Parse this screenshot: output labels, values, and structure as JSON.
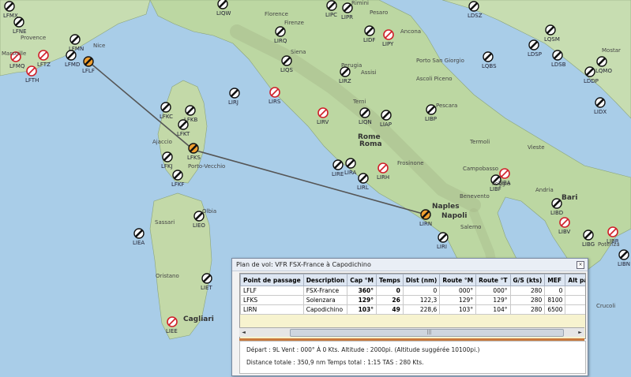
{
  "map": {
    "cities": [
      "Marseille",
      "Provence",
      "Nice",
      "Florence",
      "Firenze",
      "Rimini",
      "Pesaro",
      "Ancona",
      "Siena",
      "Perugia",
      "Assisi",
      "Porto San Giorgio",
      "Ascoli Piceno",
      "Terni",
      "Pescara",
      "Rome",
      "Roma",
      "Frosinone",
      "Termoli",
      "Vieste",
      "Campobasso",
      "Benevento",
      "Foggia",
      "Naples",
      "Napoli",
      "Salerno",
      "Andria",
      "Bari",
      "Mostar",
      "Porto-Vecchio",
      "Olbia",
      "Sassari",
      "Oristano",
      "Cagliari",
      "Potenza",
      "Crucoli",
      "Ajaccio"
    ],
    "airports": [
      "LFMX",
      "LFNE",
      "LFMN",
      "LFMD",
      "LFTZ",
      "LFTH",
      "LFMQ",
      "LFLF",
      "LIQW",
      "LIRQ",
      "LIPC",
      "LIPR",
      "LIDF",
      "LIPY",
      "LDSZ",
      "LDSB",
      "LQMO",
      "LQSM",
      "LQBS",
      "LDDP",
      "LDSP",
      "LIQS",
      "LIRZ",
      "LIRS",
      "LIRJ",
      "LFKC",
      "LFKB",
      "LFKT",
      "LFKS",
      "LFKJ",
      "LFKF",
      "LIRV",
      "LIQN",
      "LIAP",
      "LIBP",
      "LIRA",
      "LIRL",
      "LIRE",
      "LIRH",
      "LIBF",
      "LIBA",
      "LIRN",
      "LIRI",
      "LIBD",
      "LIBV",
      "LIBG",
      "LIBR",
      "LIBN",
      "LIEO",
      "LIEA",
      "LIET",
      "LIEE",
      "LIDX"
    ]
  },
  "panel": {
    "title": "Plan de vol: VFR FSX-France à Capodichino",
    "close": "×",
    "columns": [
      "Point de passage",
      "Description",
      "Cap °M",
      "Temps",
      "Dist (nm)",
      "Route °M",
      "Route °T",
      "G/S (kts)",
      "MEF",
      "Alt par"
    ],
    "rows": [
      {
        "wp": "LFLF",
        "desc": "FSX-France",
        "cap": "360°",
        "temps": "0",
        "dist": "0",
        "rm": "000°",
        "rt": "000°",
        "gs": "280",
        "mef": "0"
      },
      {
        "wp": "LFKS",
        "desc": "Solenzara",
        "cap": "129°",
        "temps": "26",
        "dist": "122,3",
        "rm": "129°",
        "rt": "129°",
        "gs": "280",
        "mef": "8100"
      },
      {
        "wp": "LIRN",
        "desc": "Capodichino",
        "cap": "103°",
        "temps": "49",
        "dist": "228,6",
        "rm": "103°",
        "rt": "104°",
        "gs": "280",
        "mef": "6500"
      }
    ],
    "scroll_left": "◄",
    "scroll_right": "►",
    "scroll_grip": "|||",
    "summary": {
      "line1": "Départ :  9L    Vent :  000° À 0 Kts.     Altitude :  2000pi. (Altitude suggérée 10100pi.)",
      "line2": "Distance totale :  350,9 nm       Temps total :  1:15       TAS :  280 Kts."
    }
  }
}
